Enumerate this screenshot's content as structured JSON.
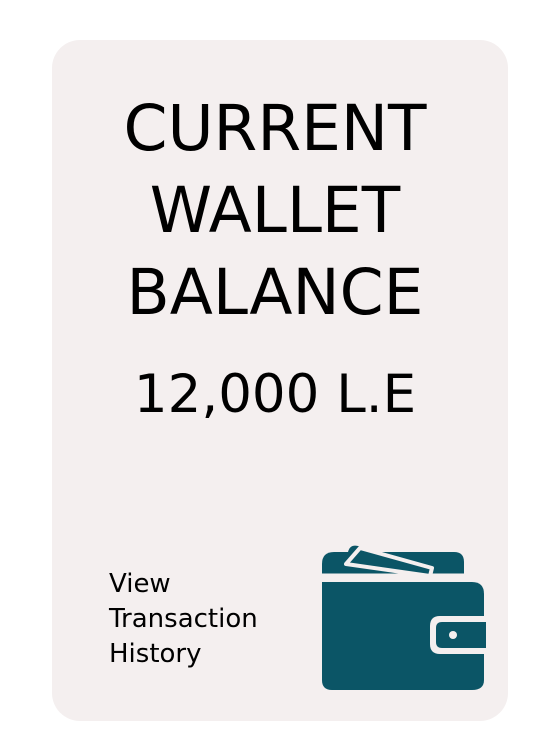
{
  "card": {
    "title_lines": [
      "CURRENT",
      "WALLET",
      "BALANCE"
    ],
    "balance": "12,000 L.E",
    "history_link_lines": [
      "View",
      "Transaction",
      "History"
    ],
    "icon": "wallet-icon",
    "colors": {
      "card_background": "#f4efef",
      "icon": "#0b5566",
      "text": "#000000"
    }
  }
}
